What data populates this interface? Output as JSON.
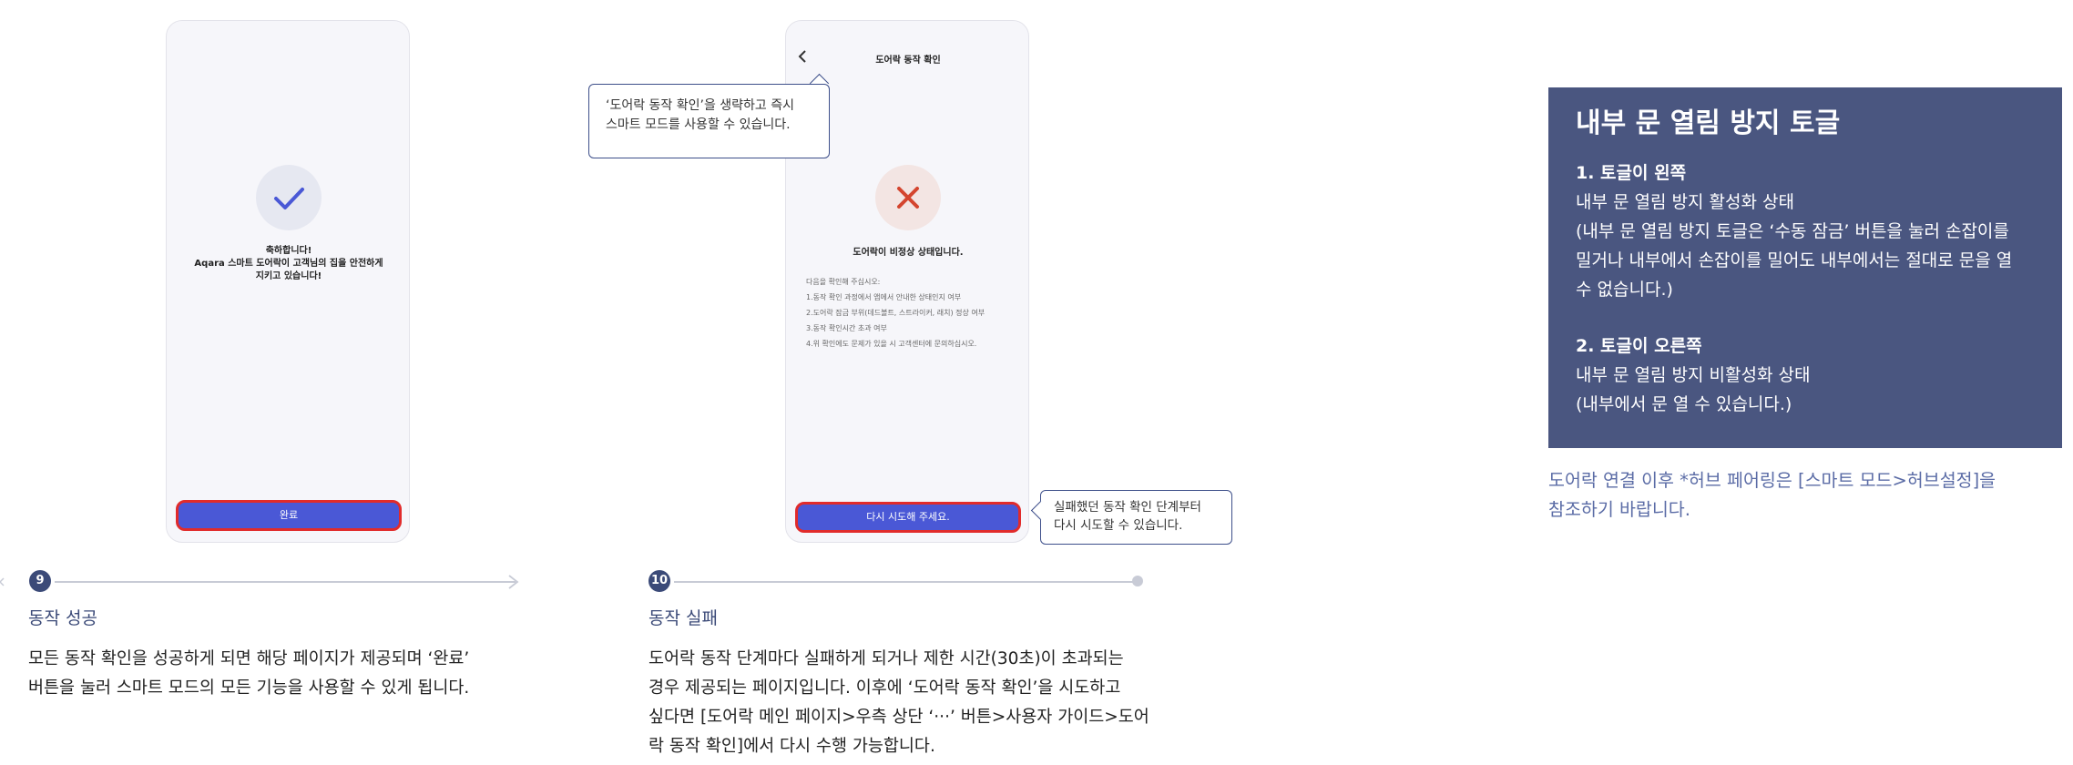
{
  "step9": {
    "phone": {
      "congrats_line1": "축하합니다!",
      "congrats_line2": "Aqara 스마트 도어락이 고객님의 집을 안전하게",
      "congrats_line3": "지키고 있습니다!",
      "done_button": "완료"
    },
    "number": "9",
    "title": "동작 성공",
    "desc_line1": "모든 동작 확인을 성공하게 되면 해당 페이지가 제공되며 ‘완료’",
    "desc_line2": "버튼을 눌러 스마트 모드의 모든 기능을 사용할 수 있게 됩니다."
  },
  "step10": {
    "phone": {
      "title": "도어락 동작 확인",
      "status": "도어락이 비정상 상태입니다.",
      "checklist": [
        "다음을 확인해 주십시오:",
        "1.동작 확인 과정에서 앱에서 안내한 상태인지 여부",
        "2.도어락 잠금 부위(데드볼트, 스트라이커, 래치) 정상 여부",
        "3.동작 확인시간 초과 여부",
        "4.위 확인에도 문제가 있을 시 고객센터에 문의하십시오."
      ],
      "retry_button": "다시 시도해 주세요."
    },
    "callout_skip_line1": "‘도어락 동작 확인’을 생략하고 즉시",
    "callout_skip_line2": "스마트 모드를 사용할 수 있습니다.",
    "callout_retry_line1": "실패했던 동작 확인 단계부터",
    "callout_retry_line2": "다시 시도할 수 있습니다.",
    "number": "10",
    "title": "동작 실패",
    "desc_lines": [
      "도어락 동작 단계마다 실패하게 되거나 제한 시간(30초)이 초과되는",
      "경우 제공되는 페이지입니다. 이후에 ‘도어락 동작 확인’을 시도하고",
      "싶다면 [도어락 메인 페이지>우측 상단 ‘···’ 버튼>사용자 가이드>도어",
      "락 동작 확인]에서 다시 수행 가능합니다."
    ]
  },
  "info": {
    "title": "내부 문 열림 방지 토글",
    "left_heading": "1. 토글이 왼쪽",
    "left_state": "내부 문 열림 방지 활성화 상태",
    "left_desc_lines": [
      "(내부 문 열림 방지 토글은 ‘수동 잠금’ 버튼을 눌러 손잡이를",
      "밀거나 내부에서 손잡이를 밀어도 내부에서는 절대로 문을 열",
      "수 없습니다.)"
    ],
    "right_heading": "2. 토글이 오른쪽",
    "right_state": "내부 문 열림 방지 비활성화 상태",
    "right_desc": "(내부에서 문 열 수 있습니다.)",
    "note_line1": "도어락 연결 이후 *허브 페어링은 [스마트 모드>허브설정]을",
    "note_line2": "참조하기 바랍니다."
  },
  "colors": {
    "accent": "#3b4a78",
    "button": "#4a58d6",
    "highlight": "#e12b2b",
    "info_bg": "#4a5680",
    "error_x": "#d4452f",
    "check": "#4a58d6"
  },
  "icons": {
    "success": "check-icon",
    "failure": "x-icon",
    "back": "chevron-left-icon",
    "arrow": "arrow-right-icon"
  }
}
